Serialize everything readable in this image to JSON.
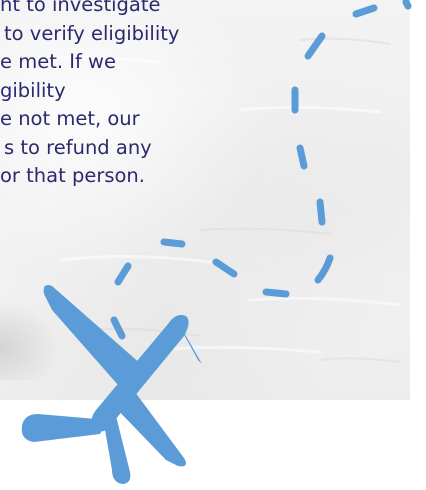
{
  "body_text": {
    "lines": [
      "ht to investigate",
      "to verify eligibility",
      "e met. If we",
      "gibility",
      "e not met, our",
      "s to refund any",
      "or that person."
    ]
  },
  "colors": {
    "text": "#2b2a6e",
    "accent_blue": "#5a9bd8"
  },
  "icons": {
    "plane": "airplane-icon",
    "path": "dashed-flight-path"
  }
}
